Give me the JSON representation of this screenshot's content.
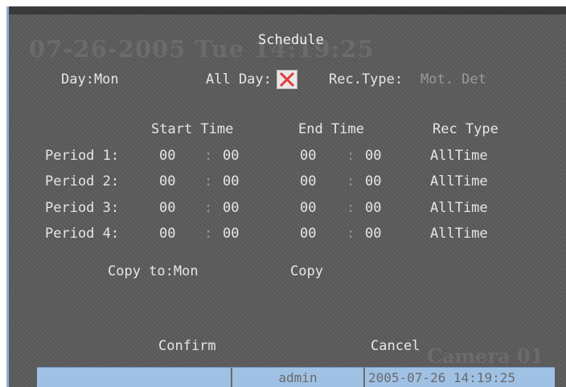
{
  "overlay": {
    "datetime": "07-26-2005 Tue 14:19:25",
    "camera": "Camera 01"
  },
  "header": {
    "title": "Schedule",
    "day_label": "Day:Mon",
    "allday_label": "All Day:",
    "allday_checked": true,
    "rectype_label": "Rec.Type:",
    "rectype_value": "Mot. Det"
  },
  "table": {
    "headers": [
      "Start Time",
      "End Time",
      "Rec Type"
    ],
    "rows": [
      {
        "label": "Period 1:",
        "start_h": "00",
        "start_m": "00",
        "end_h": "00",
        "end_m": "00",
        "type": "AllTime"
      },
      {
        "label": "Period 2:",
        "start_h": "00",
        "start_m": "00",
        "end_h": "00",
        "end_m": "00",
        "type": "AllTime"
      },
      {
        "label": "Period 3:",
        "start_h": "00",
        "start_m": "00",
        "end_h": "00",
        "end_m": "00",
        "type": "AllTime"
      },
      {
        "label": "Period 4:",
        "start_h": "00",
        "start_m": "00",
        "end_h": "00",
        "end_m": "00",
        "type": "AllTime"
      }
    ],
    "separator": ":"
  },
  "copy": {
    "copy_to_label": "Copy to:Mon",
    "copy_button": "Copy"
  },
  "actions": {
    "confirm": "Confirm",
    "cancel": "Cancel"
  },
  "status": {
    "user": "admin",
    "datetime": "2005-07-26 14:19:25"
  },
  "colors": {
    "check_mark": "#e23a3a",
    "status_bar": "#9fc1e4"
  }
}
